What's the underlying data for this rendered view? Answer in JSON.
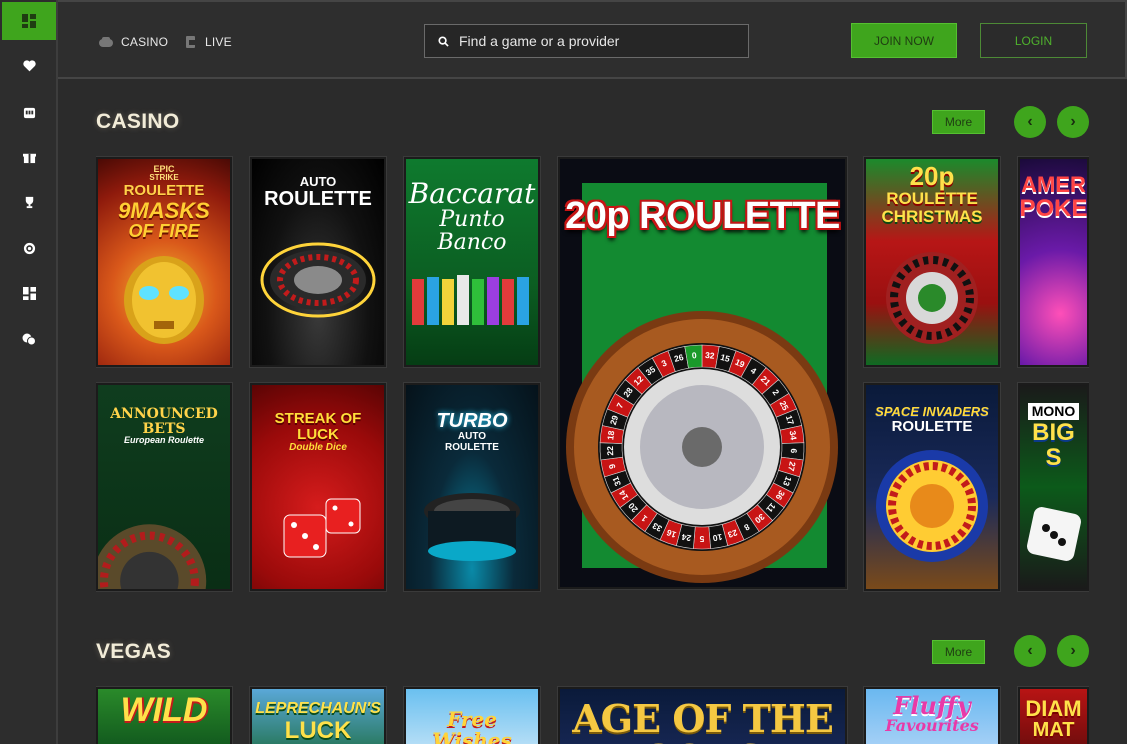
{
  "header": {
    "nav": [
      {
        "label": "CASINO",
        "icon": "gamepad-icon"
      },
      {
        "label": "LIVE",
        "icon": "live-icon"
      }
    ],
    "search_placeholder": "Find a game or a provider",
    "join_label": "JOIN NOW",
    "login_label": "LOGIN"
  },
  "sidebar": {
    "items": [
      "dashboard-icon",
      "favorites-icon",
      "slots-icon",
      "gift-icon",
      "trophy-icon",
      "target-icon",
      "grid-icon",
      "chat-icon"
    ]
  },
  "casino": {
    "title": "CASINO",
    "more_label": "More",
    "games": [
      {
        "name": "EPIC STRIKE ROULETTE 9 MASKS OF FIRE",
        "lines": [
          "EPIC",
          "STRIKE",
          "ROULETTE",
          "9MASKS",
          "OF FIRE"
        ]
      },
      {
        "name": "AUTO ROULETTE",
        "lines": [
          "AUTO",
          "ROULETTE"
        ]
      },
      {
        "name": "Baccarat Punto Banco",
        "lines": [
          "Baccarat",
          "Punto Banco"
        ]
      },
      {
        "name": "20p ROULETTE",
        "lines": [
          "20p ROULETTE"
        ]
      },
      {
        "name": "20p ROULETTE CHRISTMAS",
        "lines": [
          "20p",
          "ROULETTE",
          "CHRISTMAS"
        ]
      },
      {
        "name": "AMERICAN POKER",
        "lines": [
          "AMER",
          "POKE"
        ]
      },
      {
        "name": "ANNOUNCED BETS European Roulette",
        "lines": [
          "ANNOUNCED BETS",
          "European Roulette"
        ]
      },
      {
        "name": "STREAK OF LUCK Double Dice",
        "lines": [
          "STREAK OF LUCK",
          "Double Dice"
        ]
      },
      {
        "name": "TURBO AUTO ROULETTE",
        "lines": [
          "TURBO",
          "AUTO",
          "ROULETTE"
        ]
      },
      {
        "name": "SPACE INVADERS ROULETTE",
        "lines": [
          "SPACE INVADERS",
          "ROULETTE"
        ]
      },
      {
        "name": "MONOPOLY BIG SPIN",
        "lines": [
          "MONO",
          "BIG S"
        ]
      }
    ],
    "wheel_numbers": [
      "32",
      "15",
      "19",
      "4",
      "21",
      "2",
      "25",
      "17",
      "34",
      "6",
      "27",
      "13",
      "36",
      "11",
      "30",
      "8",
      "23",
      "10",
      "5",
      "24",
      "16",
      "33",
      "1",
      "20",
      "14",
      "31",
      "9",
      "22",
      "18",
      "29",
      "7",
      "28",
      "12",
      "35",
      "3",
      "26",
      "0"
    ]
  },
  "vegas": {
    "title": "VEGAS",
    "more_label": "More",
    "games": [
      {
        "name": "WILD Bells",
        "lines": [
          "WILD"
        ]
      },
      {
        "name": "LEPRECHAUN'S LUCK",
        "lines": [
          "LEPRECHAUN'S",
          "LUCK"
        ]
      },
      {
        "name": "Free Wishes",
        "lines": [
          "Free Wishes"
        ]
      },
      {
        "name": "AGE OF THE GODS",
        "lines": [
          "AGE OF THE GODS"
        ]
      },
      {
        "name": "Fluffy Favourites",
        "lines": [
          "Fluffy",
          "Favourites"
        ]
      },
      {
        "name": "DIAMOND MATRIX",
        "lines": [
          "DIAM",
          "MAT"
        ]
      }
    ]
  },
  "colors": {
    "accent": "#3fa51d",
    "bg": "#2b2b2b",
    "title": "#f2ecd8"
  }
}
